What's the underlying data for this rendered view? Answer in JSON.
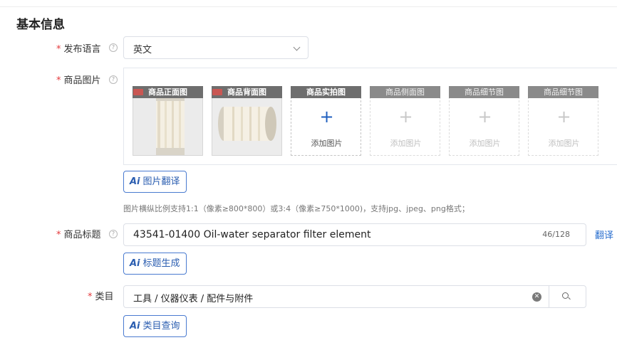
{
  "section": {
    "title": "基本信息"
  },
  "language": {
    "label": "发布语言",
    "value": "英文"
  },
  "images": {
    "label": "商品图片",
    "slots": [
      {
        "title": "商品正面图",
        "state": "filled"
      },
      {
        "title": "商品背面图",
        "state": "filled"
      },
      {
        "title": "商品实拍图",
        "state": "empty-active",
        "add_label": "添加图片"
      },
      {
        "title": "商品侧面图",
        "state": "empty-disabled",
        "add_label": "添加图片"
      },
      {
        "title": "商品细节图",
        "state": "empty-disabled",
        "add_label": "添加图片"
      },
      {
        "title": "商品细节图",
        "state": "empty-disabled",
        "add_label": "添加图片"
      }
    ],
    "ai_button": "图片翻译",
    "hint": "图片横纵比例支持1:1（像素≥800*800）或3:4（像素≥750*1000)，支持jpg、jpeg、png格式；"
  },
  "product_title": {
    "label": "商品标题",
    "value": "43541-01400 Oil-water separator filter element",
    "count": "46/128",
    "translate_link": "翻译",
    "ai_button": "标题生成"
  },
  "category": {
    "label": "类目",
    "value": "工具 / 仪器仪表 / 配件与附件",
    "ai_button": "类目查询"
  },
  "common": {
    "required_mark": "*",
    "help_glyph": "?",
    "ai_glyph": "Ai",
    "plus_glyph": "+",
    "clear_glyph": "✕"
  },
  "colors": {
    "accent": "#2a5db0",
    "required": "#e4393c",
    "link": "#2a6fcf"
  }
}
